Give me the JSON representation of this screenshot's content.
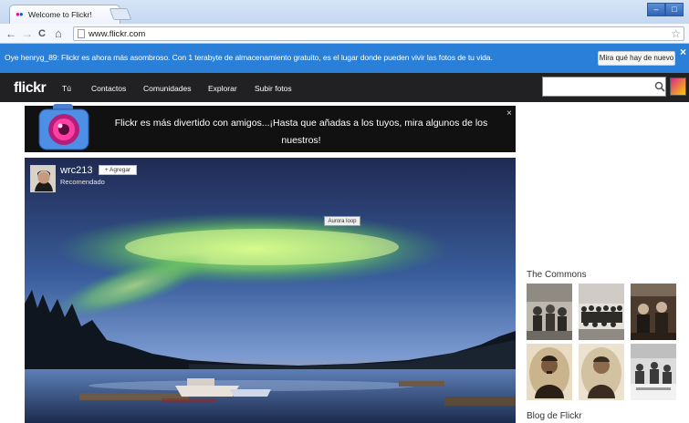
{
  "browser": {
    "tab_title": "Welcome to Flickr!",
    "tab_close": "×",
    "url": "www.flickr.com",
    "nav": {
      "back": "←",
      "forward": "→",
      "reload": "C",
      "home": "⌂"
    },
    "star": "☆",
    "window_buttons": [
      "–",
      "□"
    ]
  },
  "notice": {
    "text": "Oye henryg_89: Flickr es ahora más asombroso. Con 1 terabyte de almacenamiento gratuito, es el lugar donde pueden vivir las fotos de tu vida.",
    "button": "Mira qué hay de nuevo",
    "close": "×"
  },
  "nav": {
    "logo": "flickr",
    "items": [
      "Tú",
      "Contactos",
      "Comunidades",
      "Explorar",
      "Subir fotos"
    ]
  },
  "promo": {
    "text": "Flickr es más divertido con amigos...¡Hasta que añadas a los tuyos, mira algunos de los nuestros!",
    "close": "×"
  },
  "photo": {
    "owner": "wrc213",
    "owner_sub": "Recomendado",
    "add_button": "+ Agregar",
    "tooltip": "Aurora loop"
  },
  "sidebar": {
    "commons_title": "The Commons",
    "blog_title": "Blog de Flickr"
  },
  "colors": {
    "notice_bg": "#2a7fd9",
    "nav_bg": "#212124",
    "flickr_pink": "#ff0084",
    "flickr_blue": "#0063dc"
  }
}
